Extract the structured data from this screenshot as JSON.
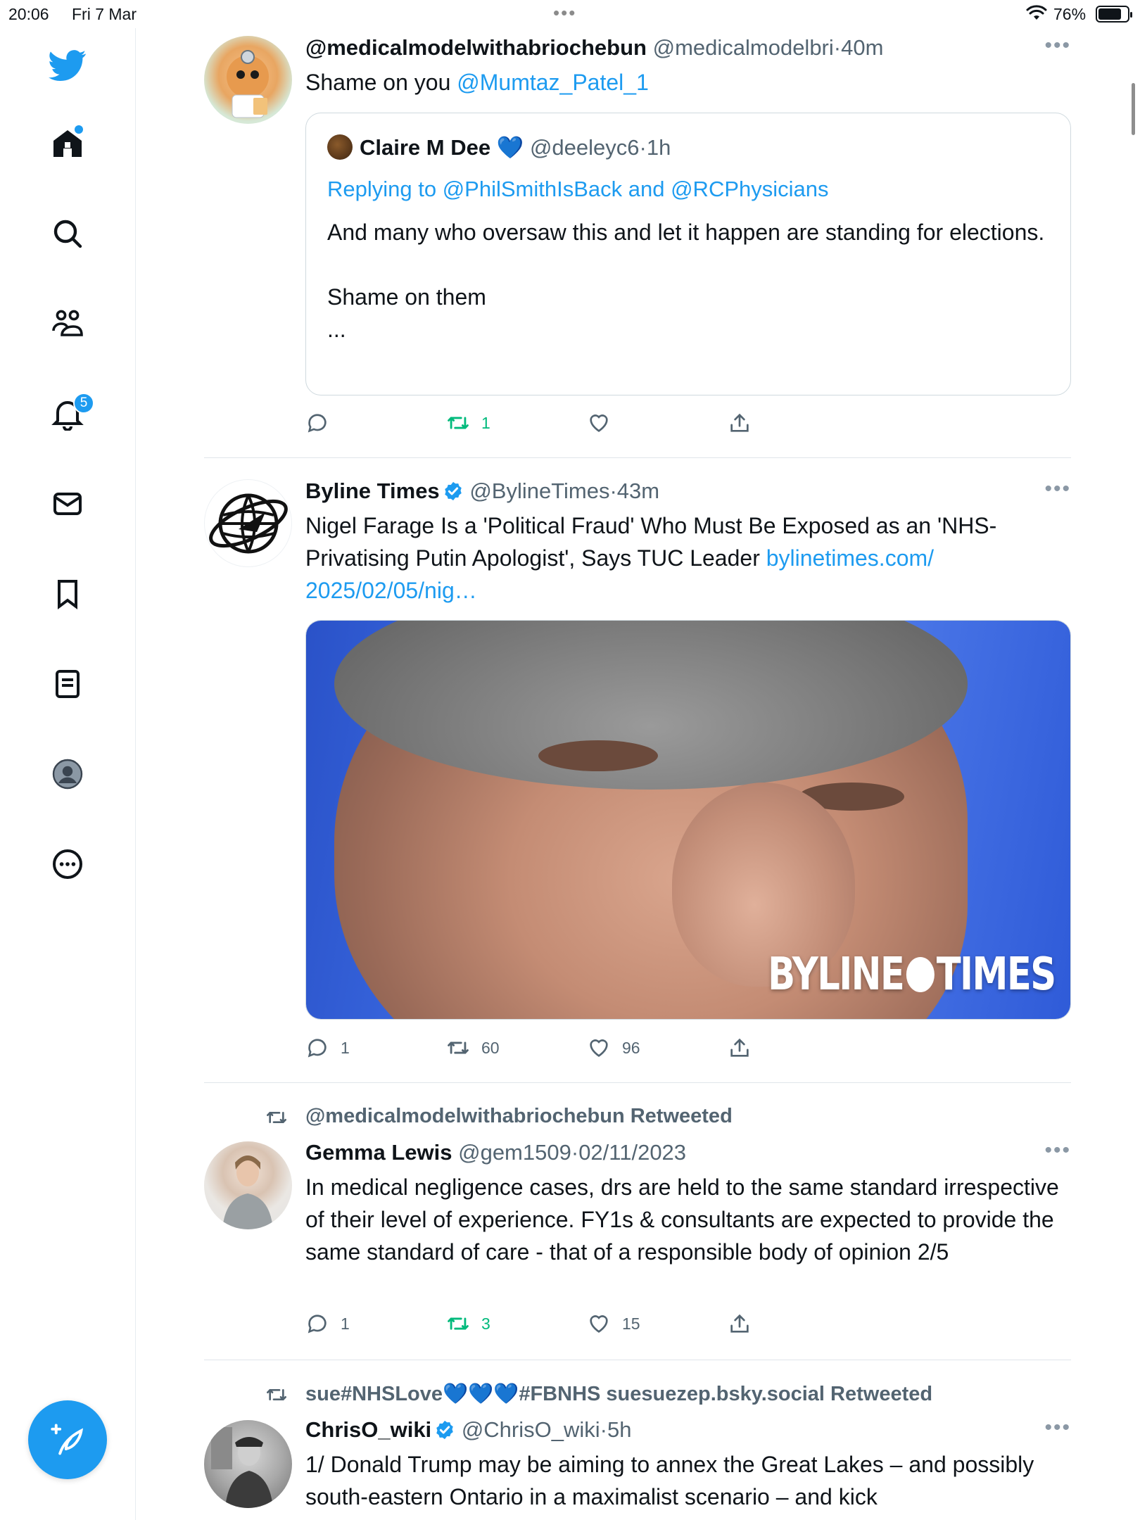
{
  "status_bar": {
    "time": "20:06",
    "date": "Fri 7 Mar",
    "battery_pct": "76%"
  },
  "sidebar": {
    "notifications_badge": "5",
    "items": [
      "twitter-logo",
      "home",
      "explore",
      "communities",
      "notifications",
      "messages",
      "bookmarks",
      "lists",
      "profile",
      "more"
    ]
  },
  "tweets": [
    {
      "name": "@medicalmodelwithabriochebun",
      "handle": "@medicalmodelbri",
      "sep": "·",
      "time": "40m",
      "text_prefix": "Shame on you ",
      "mention": "@Mumtaz_Patel_1",
      "quote": {
        "name": "Claire M Dee",
        "heart": "💙",
        "handle": "@deeleyc6",
        "sep": "·",
        "time": "1h",
        "replying": "Replying to @PhilSmithIsBack and @RCPhysicians",
        "text": "And many who oversaw this and let it happen are standing for elections.\n\nShame on them\n..."
      },
      "actions": {
        "replies": "",
        "retweets": "1",
        "likes": ""
      }
    },
    {
      "name": "Byline Times",
      "handle": "@BylineTimes",
      "sep": "·",
      "time": "43m",
      "text": "Nigel Farage Is a 'Political Fraud' Who Must Be Exposed as an 'NHS-Privatising Putin Apologist', Says TUC Leader ",
      "link": "bylinetimes.com/ 2025/02/05/nig…",
      "media_brand_left": "BYLINE",
      "media_brand_right": "TIMES",
      "actions": {
        "replies": "1",
        "retweets": "60",
        "likes": "96"
      }
    },
    {
      "retweeted_by": "@medicalmodelwithabriochebun Retweeted",
      "name": "Gemma Lewis",
      "handle": "@gem1509",
      "sep": "·",
      "time": "02/11/2023",
      "text": "In medical negligence cases, drs are held to the same standard irrespective of their level of experience. FY1s & consultants are expected to provide the same standard of care - that of a responsible body of opinion 2/5",
      "actions": {
        "replies": "1",
        "retweets": "3",
        "likes": "15"
      }
    },
    {
      "retweeted_by": "sue#NHSLove💙💙💙#FBNHS suesuezep.bsky.social Retweeted",
      "name": "ChrisO_wiki",
      "handle": "@ChrisO_wiki",
      "sep": "·",
      "time": "5h",
      "text": "1/ Donald Trump may be aiming to annex the Great Lakes – and possibly south-eastern Ontario in a maximalist scenario – and kick"
    }
  ],
  "colors": {
    "accent": "#1d9bf0",
    "retweet_green": "#00ba7c",
    "muted": "#536471"
  }
}
